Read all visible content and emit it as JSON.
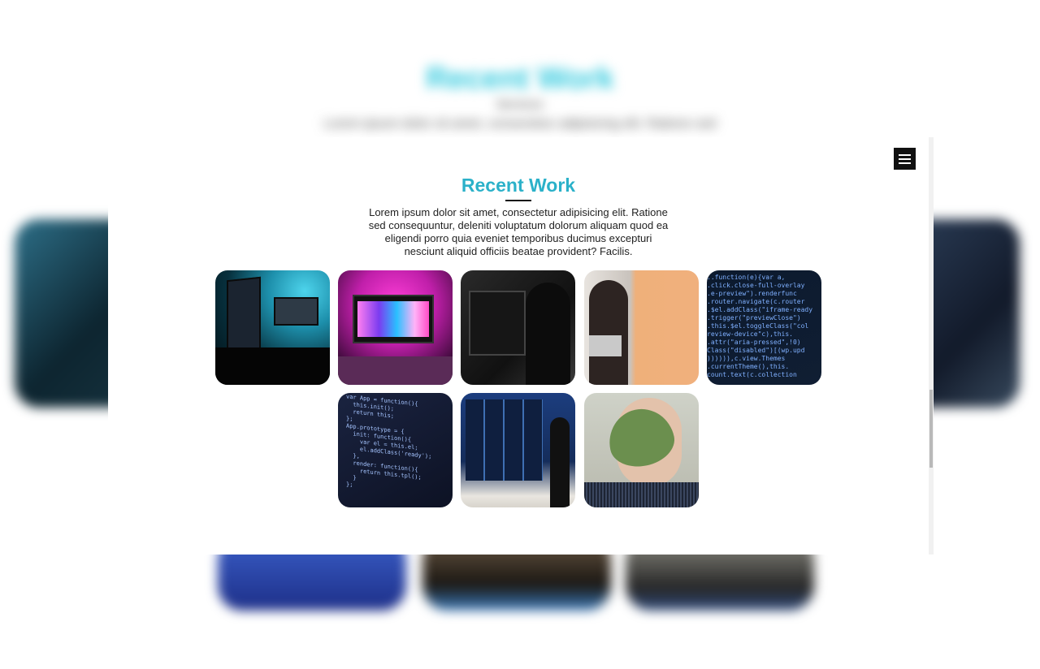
{
  "background_page": {
    "title": "Recent Work",
    "subtitle": "Services",
    "text": "Lorem ipsum dolor sit amet, consectetur adipisicing elit. Ratione sed"
  },
  "menu": {
    "icon": "hamburger-menu-icon"
  },
  "section": {
    "title": "Recent Work",
    "description": "Lorem ipsum dolor sit amet, consectetur adipisicing elit. Ratione sed consequuntur, deleniti voluptatum dolorum aliquam quod ea eligendi porro quia eveniet temporibus ducimus excepturi nesciunt aliquid officiis beatae provident? Facilis.",
    "title_color": "#2bb1c9"
  },
  "gallery": {
    "items": [
      {
        "name": "dual-monitor-desk-setup"
      },
      {
        "name": "pink-neon-desktop"
      },
      {
        "name": "person-at-monitor-dark"
      },
      {
        "name": "woman-with-laptop"
      },
      {
        "name": "code-screen-closeup"
      },
      {
        "name": "code-editor-screen"
      },
      {
        "name": "server-room-person"
      },
      {
        "name": "woman-with-leaf"
      }
    ]
  }
}
